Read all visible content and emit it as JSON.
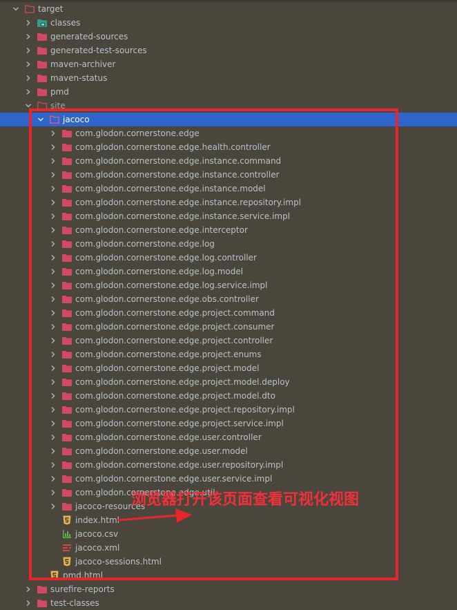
{
  "tree": [
    {
      "label": "target",
      "icon": "folder-outline-icon",
      "expanded": true
    },
    {
      "label": "classes",
      "icon": "folder-classes-icon",
      "expanded": false
    },
    {
      "label": "generated-sources",
      "icon": "folder-icon",
      "expanded": false
    },
    {
      "label": "generated-test-sources",
      "icon": "folder-icon",
      "expanded": false
    },
    {
      "label": "maven-archiver",
      "icon": "folder-icon",
      "expanded": false
    },
    {
      "label": "maven-status",
      "icon": "folder-icon",
      "expanded": false
    },
    {
      "label": "pmd",
      "icon": "folder-icon",
      "expanded": false
    },
    {
      "label": "site",
      "icon": "folder-outline-icon",
      "expanded": true
    },
    {
      "label": "jacoco",
      "icon": "folder-outline-icon",
      "expanded": true,
      "selected": true
    },
    {
      "label": "com.glodon.cornerstone.edge",
      "icon": "folder-icon"
    },
    {
      "label": "com.glodon.cornerstone.edge.health.controller",
      "icon": "folder-icon"
    },
    {
      "label": "com.glodon.cornerstone.edge.instance.command",
      "icon": "folder-icon"
    },
    {
      "label": "com.glodon.cornerstone.edge.instance.controller",
      "icon": "folder-icon"
    },
    {
      "label": "com.glodon.cornerstone.edge.instance.model",
      "icon": "folder-icon"
    },
    {
      "label": "com.glodon.cornerstone.edge.instance.repository.impl",
      "icon": "folder-icon"
    },
    {
      "label": "com.glodon.cornerstone.edge.instance.service.impl",
      "icon": "folder-icon"
    },
    {
      "label": "com.glodon.cornerstone.edge.interceptor",
      "icon": "folder-icon"
    },
    {
      "label": "com.glodon.cornerstone.edge.log",
      "icon": "folder-icon"
    },
    {
      "label": "com.glodon.cornerstone.edge.log.controller",
      "icon": "folder-icon"
    },
    {
      "label": "com.glodon.cornerstone.edge.log.model",
      "icon": "folder-icon"
    },
    {
      "label": "com.glodon.cornerstone.edge.log.service.impl",
      "icon": "folder-icon"
    },
    {
      "label": "com.glodon.cornerstone.edge.obs.controller",
      "icon": "folder-icon"
    },
    {
      "label": "com.glodon.cornerstone.edge.project.command",
      "icon": "folder-icon"
    },
    {
      "label": "com.glodon.cornerstone.edge.project.consumer",
      "icon": "folder-icon"
    },
    {
      "label": "com.glodon.cornerstone.edge.project.controller",
      "icon": "folder-icon"
    },
    {
      "label": "com.glodon.cornerstone.edge.project.enums",
      "icon": "folder-icon"
    },
    {
      "label": "com.glodon.cornerstone.edge.project.model",
      "icon": "folder-icon"
    },
    {
      "label": "com.glodon.cornerstone.edge.project.model.deploy",
      "icon": "folder-icon"
    },
    {
      "label": "com.glodon.cornerstone.edge.project.model.dto",
      "icon": "folder-icon"
    },
    {
      "label": "com.glodon.cornerstone.edge.project.repository.impl",
      "icon": "folder-icon"
    },
    {
      "label": "com.glodon.cornerstone.edge.project.service.impl",
      "icon": "folder-icon"
    },
    {
      "label": "com.glodon.cornerstone.edge.user.controller",
      "icon": "folder-icon"
    },
    {
      "label": "com.glodon.cornerstone.edge.user.model",
      "icon": "folder-icon"
    },
    {
      "label": "com.glodon.cornerstone.edge.user.repository.impl",
      "icon": "folder-icon"
    },
    {
      "label": "com.glodon.cornerstone.edge.user.service.impl",
      "icon": "folder-icon"
    },
    {
      "label": "com.glodon.cornerstone.edge.util",
      "icon": "folder-icon"
    },
    {
      "label": "jacoco-resources",
      "icon": "folder-icon"
    },
    {
      "label": "index.html",
      "icon": "html-file-icon"
    },
    {
      "label": "jacoco.csv",
      "icon": "csv-file-icon"
    },
    {
      "label": "jacoco.xml",
      "icon": "xml-file-icon"
    },
    {
      "label": "jacoco-sessions.html",
      "icon": "html-file-icon"
    },
    {
      "label": "pmd.html",
      "icon": "html-file-icon"
    },
    {
      "label": "surefire-reports",
      "icon": "folder-icon"
    },
    {
      "label": "test-classes",
      "icon": "folder-icon"
    }
  ],
  "annotation": {
    "text": "浏览器打开该页面查看可视化视图",
    "color": "#e7262b"
  },
  "colors": {
    "background": "#4a463c",
    "selection": "#2f65ca",
    "folder": "#d24a62",
    "html_icon": "#e8b44a",
    "csv_icon": "#62b543",
    "xml_icon": "#e04545"
  }
}
